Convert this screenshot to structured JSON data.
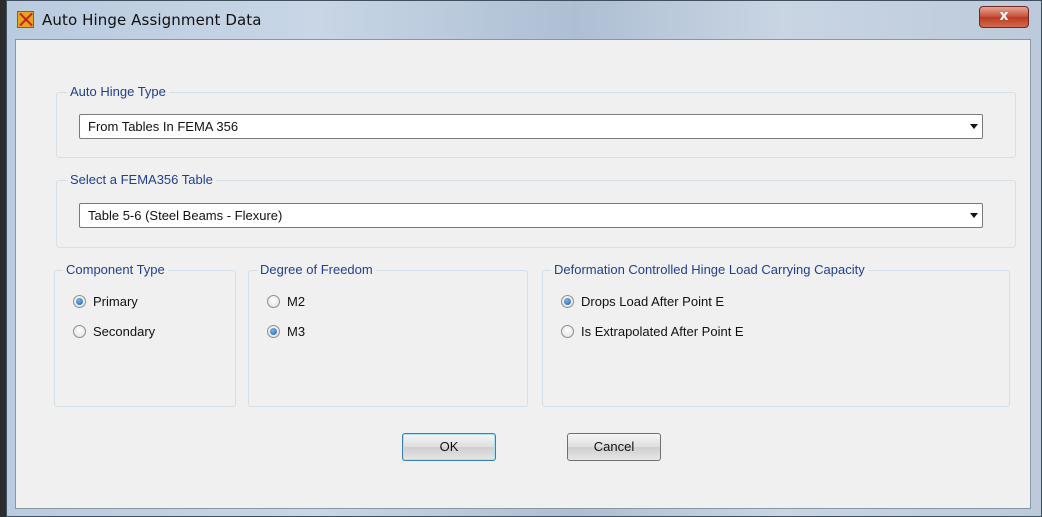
{
  "window": {
    "title": "Auto Hinge Assignment Data",
    "close_label": "x"
  },
  "auto_hinge_type": {
    "legend": "Auto Hinge Type",
    "selected": "From Tables In FEMA 356"
  },
  "fema_table": {
    "legend": "Select a FEMA356 Table",
    "selected": "Table 5-6 (Steel Beams - Flexure)"
  },
  "component_type": {
    "legend": "Component Type",
    "options": [
      {
        "label": "Primary",
        "checked": true
      },
      {
        "label": "Secondary",
        "checked": false
      }
    ]
  },
  "degree_of_freedom": {
    "legend": "Degree of Freedom",
    "options": [
      {
        "label": "M2",
        "checked": false
      },
      {
        "label": "M3",
        "checked": true
      }
    ]
  },
  "deformation_capacity": {
    "legend": "Deformation Controlled Hinge Load Carrying Capacity",
    "options": [
      {
        "label": "Drops Load After Point E",
        "checked": true
      },
      {
        "label": "Is Extrapolated After Point E",
        "checked": false
      }
    ]
  },
  "buttons": {
    "ok": "OK",
    "cancel": "Cancel"
  }
}
